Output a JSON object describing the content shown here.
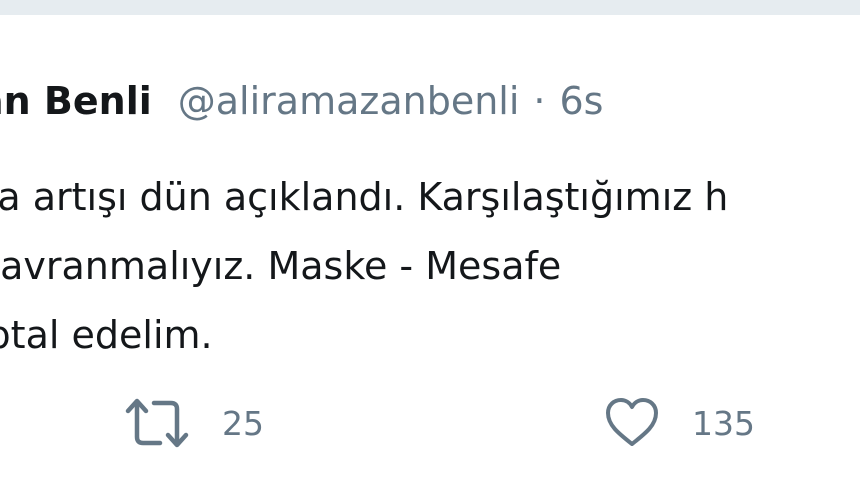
{
  "tweet": {
    "display_name": "an Benli",
    "handle": "@aliramazanbenli",
    "separator": "·",
    "timestamp": "6s",
    "text_lines": [
      "ka artışı dün açıklandı. Karşılaştığımız h",
      " davranmalıyız. Maske - Mesafe",
      "iptal edelim."
    ],
    "retweet_icon": "retweet-icon",
    "retweet_count": "25",
    "like_icon": "heart-icon",
    "like_count": "135"
  },
  "colors": {
    "primary_text": "#14171a",
    "secondary_text": "#657786",
    "background": "#e6ecf0",
    "card": "#ffffff"
  }
}
